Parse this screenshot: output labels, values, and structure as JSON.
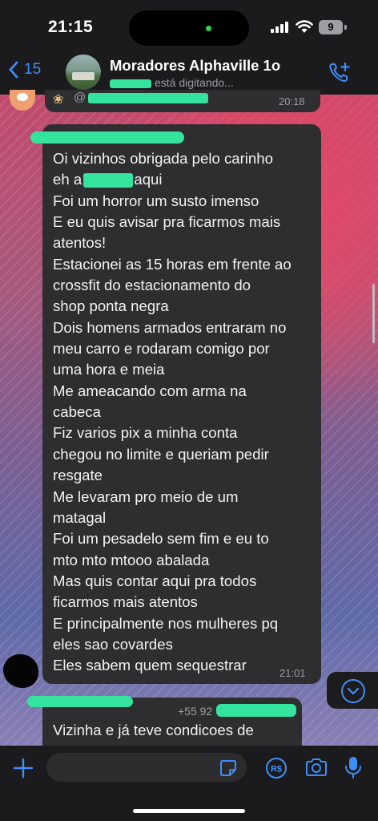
{
  "status_bar": {
    "time": "21:15",
    "battery": "9"
  },
  "header": {
    "back_count": "15",
    "title": "Moradores Alphaville 1o",
    "typing": "está digitando..."
  },
  "previous_message": {
    "mention": "@",
    "time": "20:18"
  },
  "message": {
    "lines": [
      "Oi vizinhos obrigada pelo carinho",
      "eh a ",
      "Foi um horror um susto imenso",
      "E eu quis avisar pra ficarmos mais",
      "atentos!",
      "Estacionei as 15 horas em frente ao",
      "crossfit do estacionamento do",
      "shop ponta negra",
      "Dois homens armados entraram no",
      "meu carro e rodaram comigo por",
      "uma hora e meia",
      "Me ameacando com arma na",
      "cabeca",
      "Fiz varios pix a minha conta",
      "chegou no limite e queriam pedir",
      "resgate",
      "Me levaram pro meio de um",
      "matagal",
      "Foi um pesadelo sem fim e eu to",
      "mto mto mtooo abalada",
      "Mas quis contar aqui pra todos",
      "ficarmos mais atentos",
      "E principalmente nos mulheres pq",
      "eles sao covardes",
      "Eles sabem quem sequestrar"
    ],
    "line2_suffix": "aqui",
    "time": "21:01"
  },
  "next_message": {
    "phone_prefix": "+55 92",
    "text": "Vizinha e já teve condicoes de"
  },
  "icons": {
    "back": "chevron-left-icon",
    "call_add": "phone-plus-icon",
    "scroll_down": "chevron-down-icon",
    "attach": "plus-icon",
    "sticker": "sticker-icon",
    "pay": "pix-payment-icon",
    "camera": "camera-icon",
    "mic": "microphone-icon"
  },
  "colors": {
    "accent": "#3e8ef7",
    "bubble": "#2e2e30",
    "redaction": "#34e39c"
  }
}
